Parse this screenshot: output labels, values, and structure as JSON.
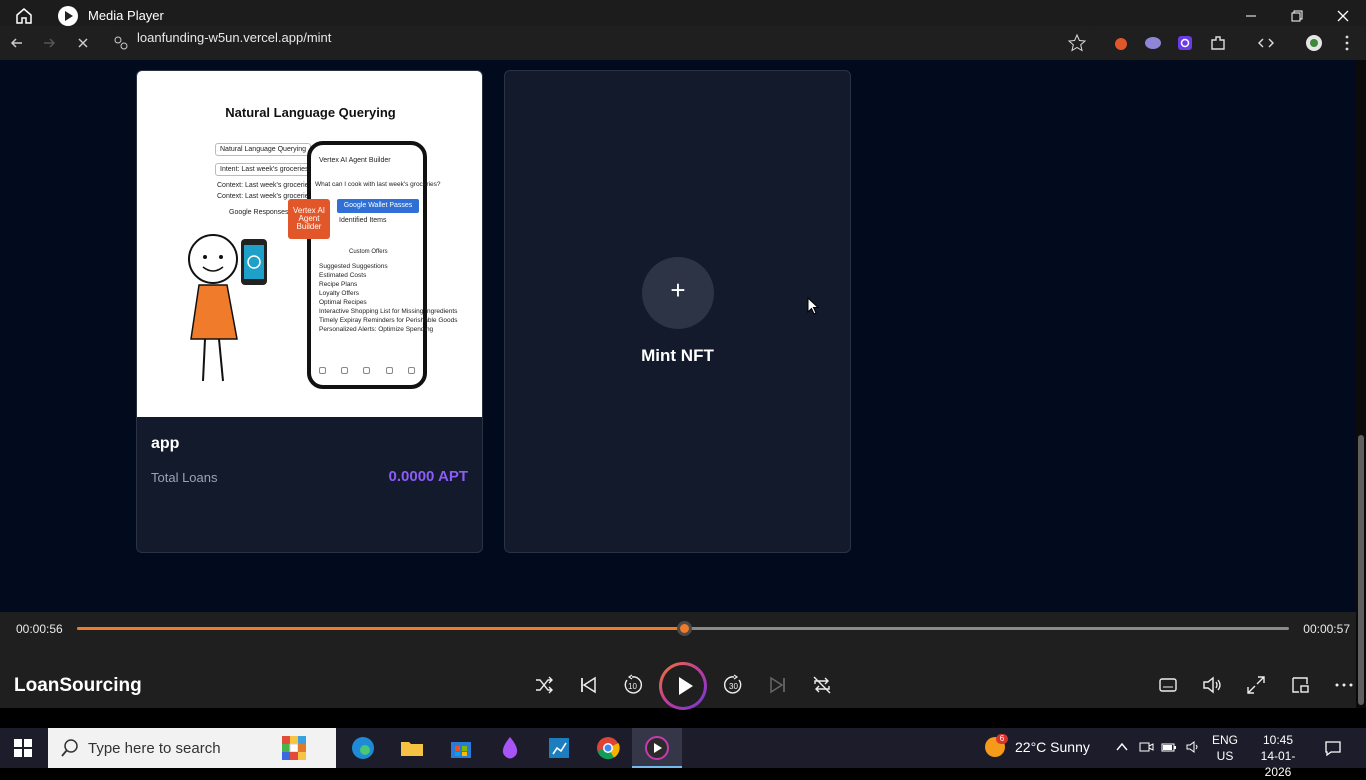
{
  "titlebar": {
    "title": "Media Player"
  },
  "browser": {
    "url": "loanfunding-w5un.vercel.app/mint"
  },
  "cards": {
    "app": {
      "art": {
        "title": "Natural Language Querying",
        "pill_query": "Natural Language Querying",
        "pill_intent": "Intent: Last week's groceries?",
        "context_1": "Context: Last week's groceries?",
        "context_2": "Context: Last week's groceries?",
        "google_responses": "Google Responses",
        "vertex": "Vertex AI Agent Builder",
        "phone_header": "Vertex AI Agent Builder",
        "phone_question": "What can I cook with last week's groceries?",
        "wallet": "Google Wallet Passes",
        "identified": "Identified Items",
        "custom_offers": "Custom Offers",
        "list": [
          "Suggested Suggestions",
          "Estimated Costs",
          "Recipe Plans",
          "Loyalty Offers",
          "Optimal Recipes",
          "Interactive Shopping List for Missing Ingredients",
          "Timely Expiray Reminders for Perishable Goods",
          "Personalized Alerts: Optimize Spending"
        ]
      },
      "name": "app",
      "loan_label": "Total Loans",
      "loan_value": "0.0000 APT"
    },
    "mint": {
      "plus": "+",
      "label": "Mint NFT"
    }
  },
  "player": {
    "elapsed": "00:00:56",
    "total": "00:00:57",
    "progress_fraction": 0.501,
    "now_playing": "LoanSourcing"
  },
  "taskbar": {
    "search_placeholder": "Type here to search",
    "weather": "22°C  Sunny",
    "weather_badge": "6",
    "lang_1": "ENG",
    "lang_2": "US",
    "time": "10:45",
    "date": "14-01-2026"
  },
  "colors": {
    "accent": "#f07b2a",
    "loan_value": "#8b5cf6",
    "page_bg": "#020a1e"
  }
}
